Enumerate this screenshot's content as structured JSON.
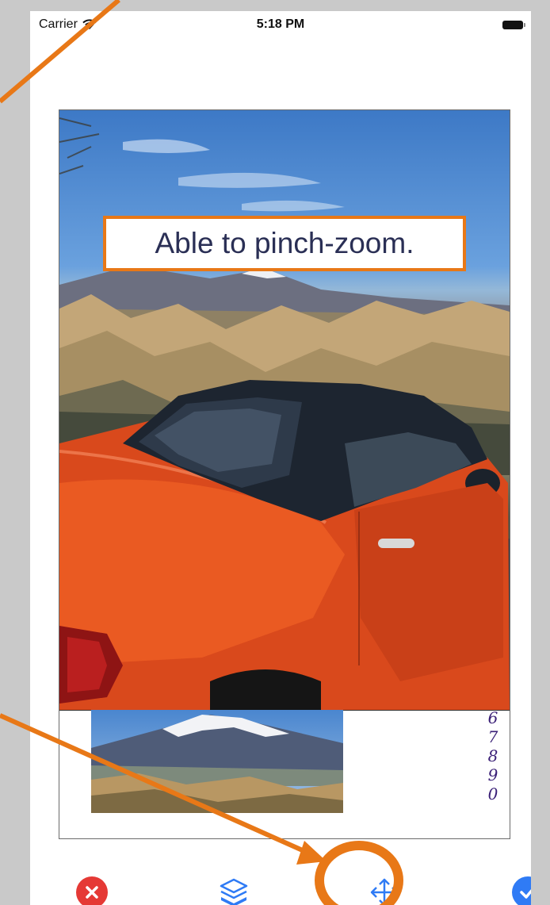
{
  "status_bar": {
    "carrier": "Carrier",
    "time": "5:18 PM"
  },
  "callout": {
    "text": "Able to pinch-zoom."
  },
  "sticker": {
    "digits": [
      "6",
      "7",
      "8",
      "9",
      "0"
    ]
  },
  "toolbar": {
    "close_icon": "close-icon",
    "layers_icon": "layers-icon",
    "move_icon": "move-arrows-icon",
    "confirm_icon": "checkmark-icon"
  },
  "colors": {
    "highlight_orange": "#e87817",
    "close_red": "#e53935",
    "ios_blue": "#2f7bf5"
  }
}
